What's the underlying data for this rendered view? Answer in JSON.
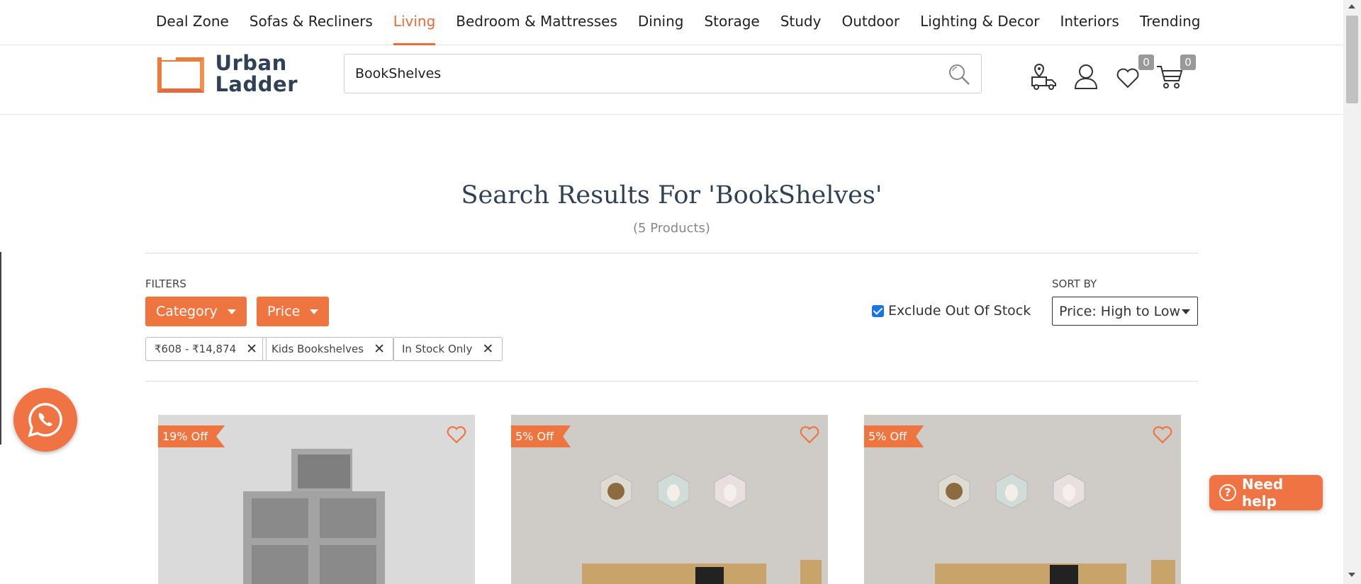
{
  "nav": {
    "items": [
      "Deal Zone",
      "Sofas & Recliners",
      "Living",
      "Bedroom & Mattresses",
      "Dining",
      "Storage",
      "Study",
      "Outdoor",
      "Lighting & Decor",
      "Interiors",
      "Trending"
    ],
    "active": "Living"
  },
  "header": {
    "logo_line1": "Urban",
    "logo_line2": "Ladder",
    "search_value": "BookShelves",
    "wishlist_count": "0",
    "cart_count": "0",
    "icons": [
      "delivery-location-icon",
      "user-icon",
      "heart-icon",
      "cart-icon",
      "search-icon"
    ]
  },
  "results": {
    "title": "Search Results For 'BookShelves'",
    "count": "(5 Products)"
  },
  "filters": {
    "label": "FILTERS",
    "category_label": "Category",
    "price_label": "Price",
    "chips": [
      "₹608 - ₹14,874",
      "Kids Bookshelves",
      "In Stock Only"
    ],
    "exclude_out_of_stock_label": "Exclude Out Of Stock",
    "exclude_checked": true
  },
  "sort": {
    "label": "SORT BY",
    "selected": "Price: High to Low"
  },
  "products": [
    {
      "discount": "19% Off"
    },
    {
      "discount": "5% Off"
    },
    {
      "discount": "5% Off"
    }
  ],
  "floating": {
    "help_label": "Need help",
    "whatsapp_icon": "whatsapp-icon"
  },
  "colors": {
    "accent": "#ee7540",
    "text_dark": "#2f4155"
  }
}
